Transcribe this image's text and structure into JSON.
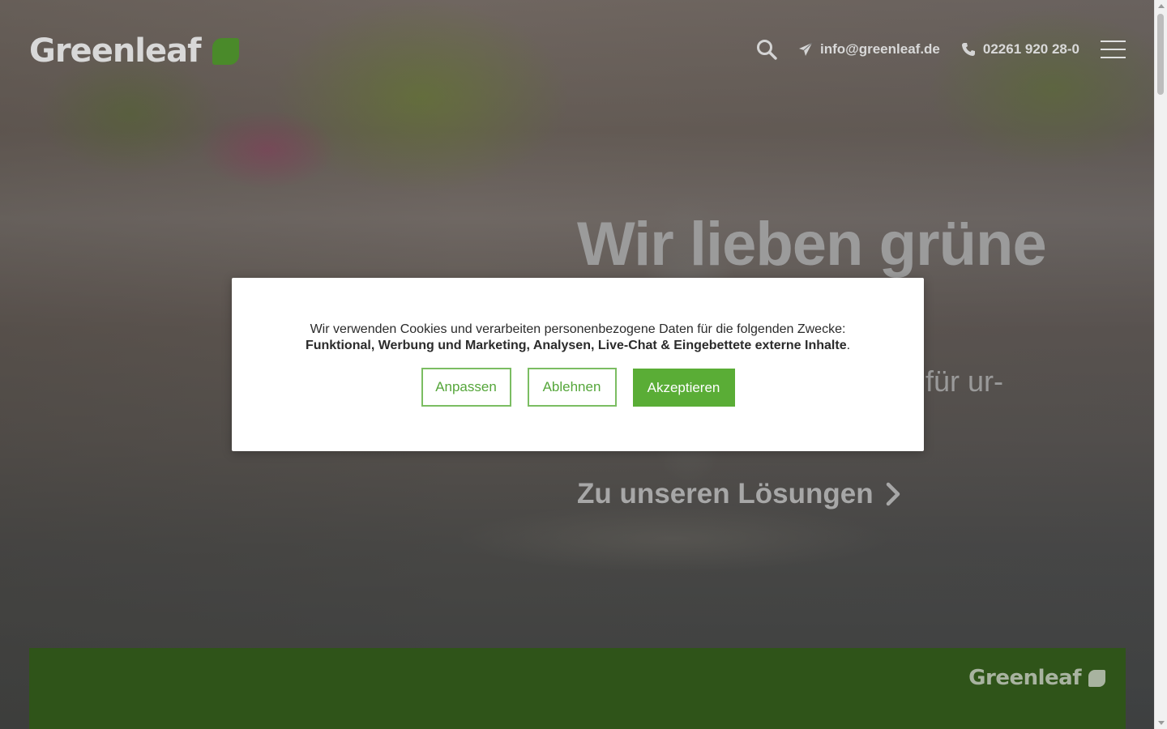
{
  "header": {
    "logo_text": "Greenleaf",
    "email": "info@greenleaf.de",
    "phone": "02261 920 28-0"
  },
  "icons": {
    "search": "search-icon",
    "email": "paper-plane-icon",
    "phone": "phone-icon",
    "menu": "hamburger-menu-icon",
    "cta": "chevron-right-icon"
  },
  "hero": {
    "title": "Wir lieben grüne",
    "subtitle_fragment": "n für ur-",
    "cta_label": "Zu unseren Lösungen"
  },
  "cookie_banner": {
    "intro": "Wir verwenden Cookies und verarbeiten personenbezogene Daten für die folgenden Zwecke:",
    "purposes": "Funktional, Werbung und Marketing, Analysen, Live-Chat & Eingebettete externe Inhalte",
    "purposes_end": ".",
    "buttons": {
      "customize": "Anpassen",
      "decline": "Ablehnen",
      "accept": "Akzeptieren"
    }
  },
  "footer_band": {
    "logo_text": "Greenleaf"
  },
  "colors": {
    "brand_green": "#4a8a2a",
    "accept_green": "#5aad36",
    "band_green": "#2f5419"
  }
}
